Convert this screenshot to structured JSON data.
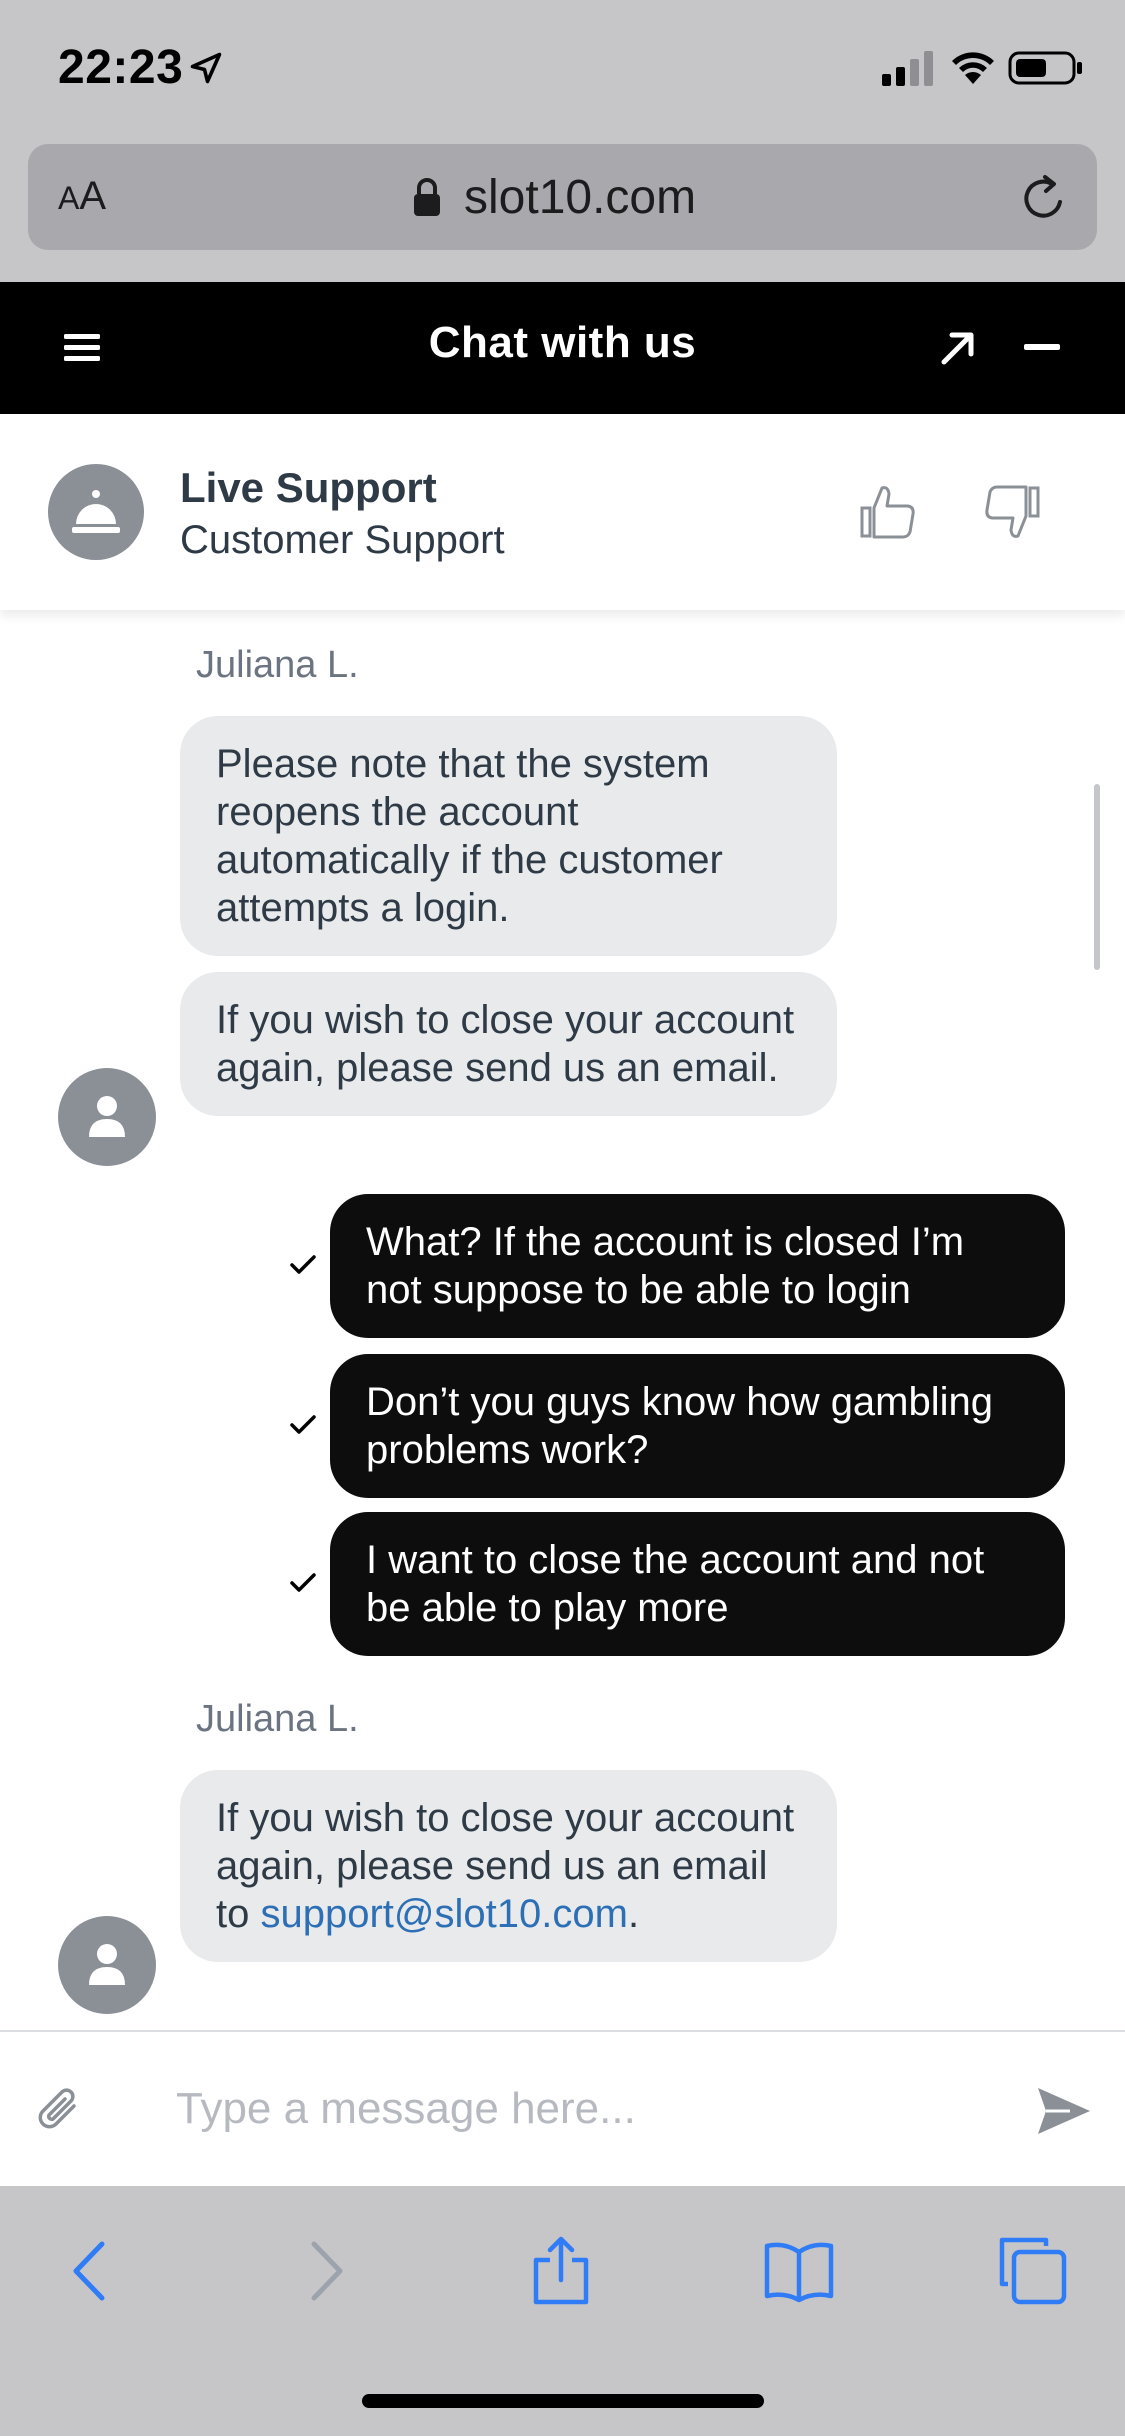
{
  "status_bar": {
    "time": "22:23"
  },
  "browser": {
    "aa_small": "A",
    "aa_large": "A",
    "url": "slot10.com"
  },
  "chat": {
    "title": "Chat with us",
    "agent": {
      "name": "Live Support",
      "role": "Customer Support"
    },
    "messages": [
      {
        "sender": "Juliana L."
      },
      {
        "text": "Please note that the system reopens the account automatically if the customer attempts a login."
      },
      {
        "text": "If you wish to close your account again, please send us an email."
      },
      {
        "text": "What? If the account is closed I’m not suppose to be able to login"
      },
      {
        "text": "Don’t you guys know how gambling problems work?"
      },
      {
        "text": "I want to close the account and not be able to play more"
      },
      {
        "sender": "Juliana L."
      },
      {
        "text_before": "If you wish to close your account again, please send us an email to ",
        "link": "support@slot10.com",
        "text_after": "."
      }
    ],
    "composer": {
      "placeholder": "Type a message here..."
    }
  },
  "icons": {
    "status": [
      "location-arrow-icon",
      "signal-icon",
      "wifi-icon",
      "battery-icon"
    ],
    "browser": [
      "lock-icon",
      "reload-icon"
    ],
    "chat": [
      "menu-icon",
      "expand-icon",
      "minimize-icon",
      "bell-icon",
      "thumbs-up-icon",
      "thumbs-down-icon",
      "user-icon",
      "check-icon",
      "attach-icon",
      "send-icon"
    ],
    "toolbar": [
      "back-icon",
      "forward-icon",
      "share-icon",
      "bookmarks-icon",
      "tabs-icon"
    ]
  },
  "colors": {
    "header_bg": "#000000",
    "incoming_bubble": "#e9eaec",
    "outgoing_bubble": "#0d0d0d",
    "link": "#2d6fb5",
    "safari_chrome": "#c6c6c9",
    "ios_blue": "#2f7cf6"
  }
}
